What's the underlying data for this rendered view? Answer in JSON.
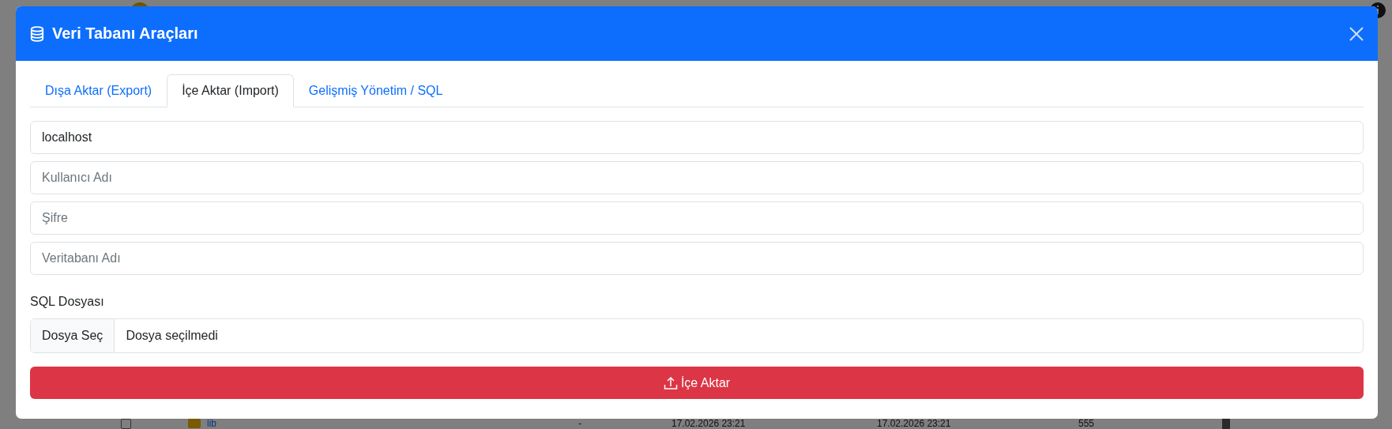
{
  "background": {
    "rows": [
      {
        "checked": false,
        "name": "lib",
        "cells": [
          "-",
          "17.02.2026 23:21",
          "17.02.2026 23:21",
          "555"
        ]
      }
    ]
  },
  "modal": {
    "title": "Veri Tabanı Araçları",
    "tabs": [
      {
        "label": "Dışa Aktar (Export)",
        "selected": false
      },
      {
        "label": "İçe Aktar (Import)",
        "selected": true
      },
      {
        "label": "Gelişmiş Yönetim / SQL",
        "selected": false
      }
    ],
    "fields": [
      {
        "value": "localhost"
      },
      {
        "placeholder": "Kullanıcı Adı"
      },
      {
        "placeholder": "Şifre"
      },
      {
        "placeholder": "Veritabanı Adı"
      }
    ],
    "file": {
      "label": "SQL Dosyası",
      "button": "Dosya Seç",
      "status": "Dosya seçilmedi"
    },
    "submit": "İçe Aktar"
  }
}
